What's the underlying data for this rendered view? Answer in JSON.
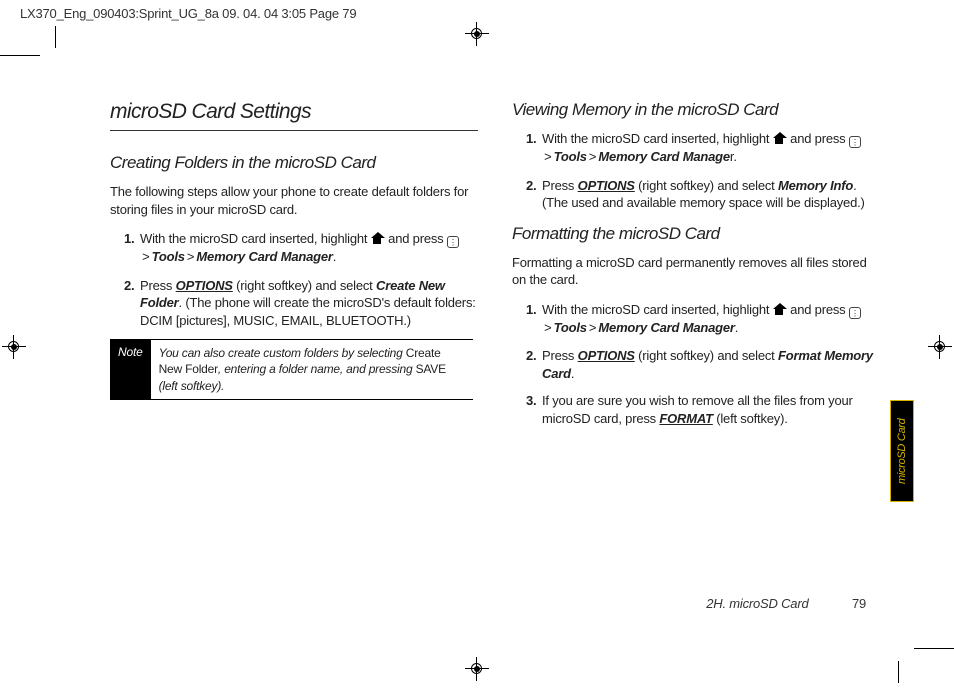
{
  "header": "LX370_Eng_090403:Sprint_UG_8a  09. 04. 04    3:05  Page 79",
  "left": {
    "h1": "microSD Card Settings",
    "h2": "Creating Folders in the microSD Card",
    "intro": "The following steps allow your phone to create default folders for storing files in your microSD card.",
    "step1_a": "With the microSD card inserted, highlight ",
    "step1_b": " and press ",
    "step1_path1": "Tools",
    "step1_path2": "Memory Card Manager",
    "step1_end": ".",
    "step2_a": "Press ",
    "step2_opt": "OPTIONS",
    "step2_b": " (right softkey) and select ",
    "step2_cmd": "Create New Folder",
    "step2_c": ". (The phone will create the microSD's default folders: DCIM [pictures], MUSIC, EMAIL, BLUETOOTH.)",
    "note_label": "Note",
    "note_a": "You can also create custom folders by selecting ",
    "note_cmd": "Create New Folder",
    "note_b": ", entering a folder name, and pressing ",
    "note_save": "SAVE",
    "note_c": " (left softkey)."
  },
  "right": {
    "h2a": "Viewing Memory in the microSD Card",
    "a1_a": "With the microSD card inserted, highlight ",
    "a1_b": " and press ",
    "a1_path1": "Tools",
    "a1_path2": "Memory Card Manage",
    "a1_end": "r.",
    "a2_a": "Press ",
    "a2_opt": "OPTIONS",
    "a2_b": " (right softkey) and select ",
    "a2_cmd": "Memory Info",
    "a2_c": ". (The used and available memory space will be displayed.)",
    "h2b": "Formatting the microSD Card",
    "intro_b": "Formatting a microSD card permanently removes all files stored on the card.",
    "b1_a": "With the microSD card inserted, highlight ",
    "b1_b": " and press ",
    "b1_path1": "Tools",
    "b1_path2": "Memory Card Manager",
    "b1_end": ".",
    "b2_a": "Press ",
    "b2_opt": "OPTIONS",
    "b2_b": " (right softkey) and select ",
    "b2_cmd": "Format Memory Card",
    "b2_c": ".",
    "b3_a": "If you are sure you wish to remove all the files from your microSD card, press ",
    "b3_cmd": "FORMAT",
    "b3_b": " (left softkey)."
  },
  "side_tab": "microSD Card",
  "footer_section": "2H. microSD Card",
  "footer_page": "79"
}
